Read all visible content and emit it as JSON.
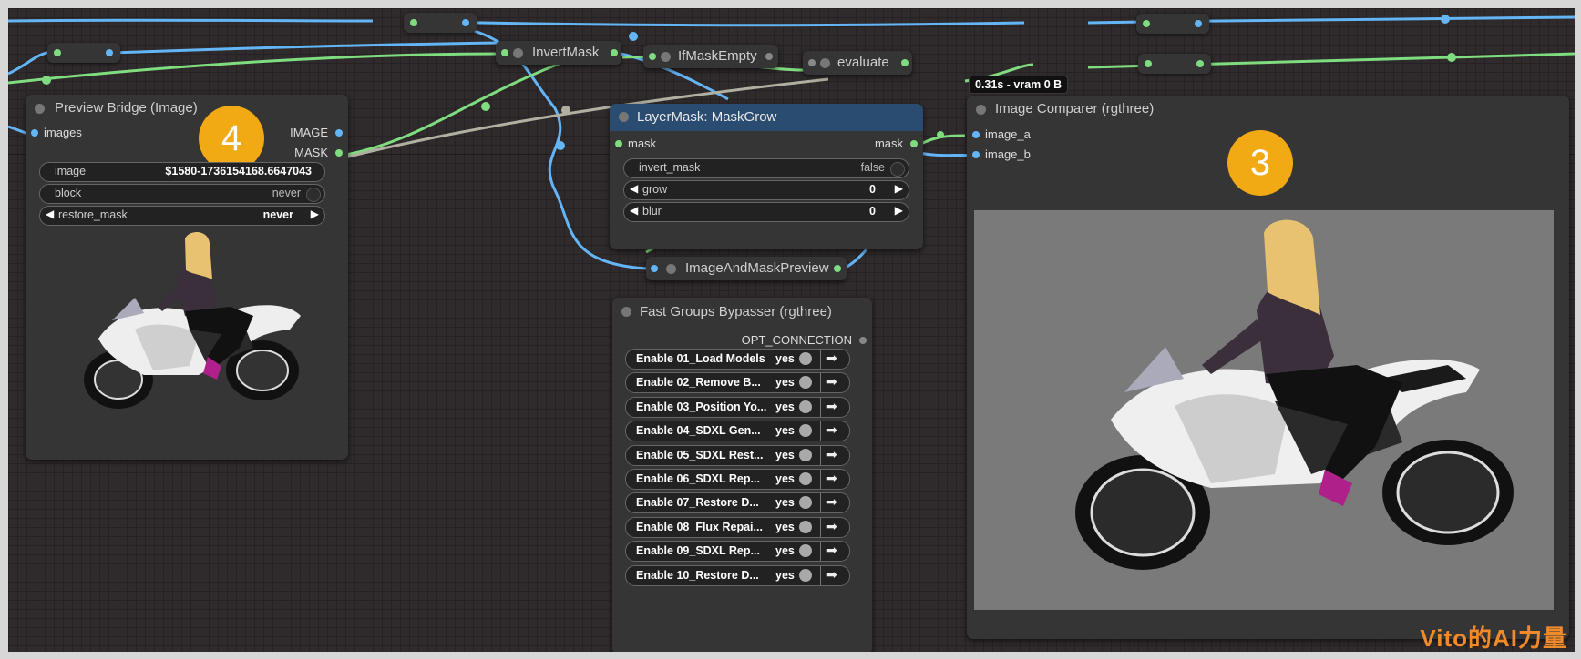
{
  "nodes": {
    "preview_bridge": {
      "title": "Preview Bridge (Image)",
      "input_images": "images",
      "output_image": "IMAGE",
      "output_mask": "MASK",
      "widgets": {
        "image_label": "image",
        "image_value": "$1580-1736154168.6647043",
        "block_label": "block",
        "block_value": "never",
        "restore_mask_label": "restore_mask",
        "restore_mask_value": "never"
      },
      "badge": "4"
    },
    "invert_mask": {
      "title": "InvertMask"
    },
    "if_mask_empty": {
      "title": "IfMaskEmpty"
    },
    "evaluate": {
      "title": "evaluate"
    },
    "layermask_grow": {
      "title": "LayerMask: MaskGrow",
      "input_mask": "mask",
      "output_mask": "mask",
      "widgets": {
        "invert_mask_label": "invert_mask",
        "invert_mask_value": "false",
        "grow_label": "grow",
        "grow_value": "0",
        "blur_label": "blur",
        "blur_value": "0"
      }
    },
    "image_and_mask_preview": {
      "title": "ImageAndMaskPreview"
    },
    "fast_groups_bypasser": {
      "title": "Fast Groups Bypasser (rgthree)",
      "output": "OPT_CONNECTION",
      "rows": [
        {
          "label": "Enable 01_Load Models",
          "value": "yes"
        },
        {
          "label": "Enable 02_Remove B...",
          "value": "yes"
        },
        {
          "label": "Enable 03_Position Yo...",
          "value": "yes"
        },
        {
          "label": "Enable 04_SDXL Gen...",
          "value": "yes"
        },
        {
          "label": "Enable 05_SDXL Rest...",
          "value": "yes"
        },
        {
          "label": "Enable 06_SDXL Rep...",
          "value": "yes"
        },
        {
          "label": "Enable 07_Restore D...",
          "value": "yes"
        },
        {
          "label": "Enable 08_Flux Repai...",
          "value": "yes"
        },
        {
          "label": "Enable 09_SDXL Rep...",
          "value": "yes"
        },
        {
          "label": "Enable 10_Restore D...",
          "value": "yes"
        }
      ]
    },
    "image_comparer": {
      "title": "Image Comparer (rgthree)",
      "input_a": "image_a",
      "input_b": "image_b",
      "badge": "3",
      "timing": "0.31s - vram 0 B"
    }
  },
  "watermark": "Vito的AI力量",
  "colors": {
    "canvas": "#2f2a2c",
    "node": "#353535",
    "node_title_blue": "#2a4c70",
    "wire_blue": "#64b5f6",
    "wire_green": "#7fdc7f",
    "wire_gray": "#b0b0a0",
    "badge": "#f1a914",
    "comparer_bg": "#7a7a7a"
  },
  "icons": [
    "arrow-right-icon",
    "arrow-left-icon",
    "motorcycle-rider-image"
  ]
}
